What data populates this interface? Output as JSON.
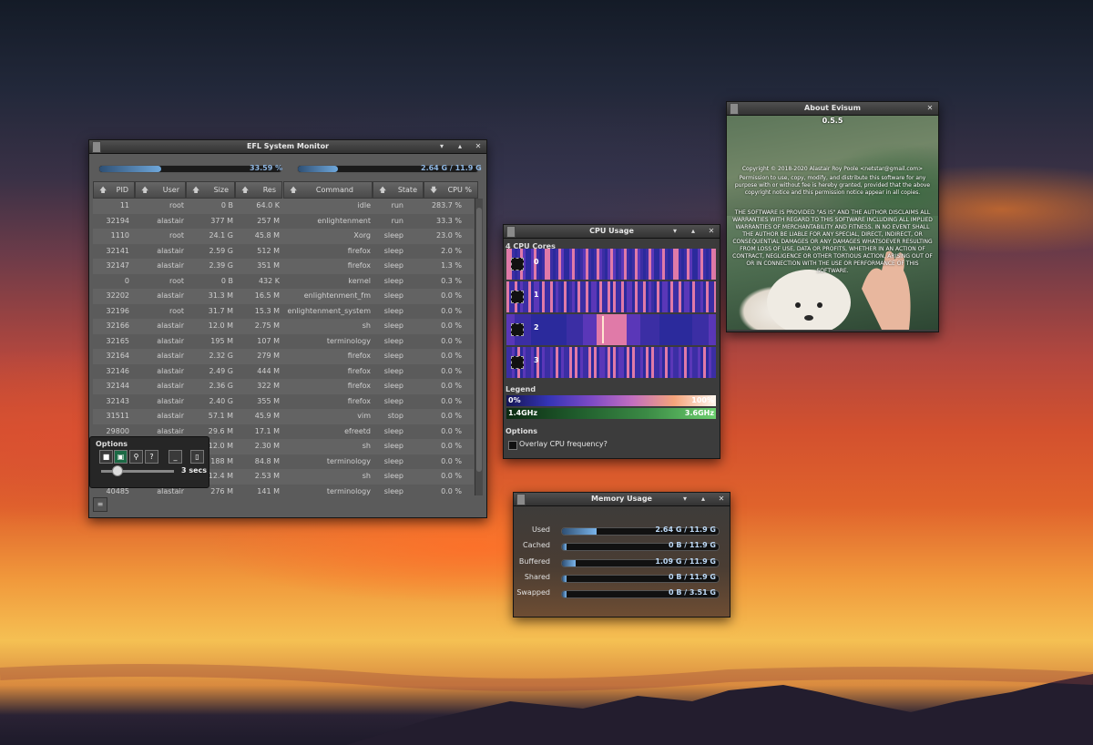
{
  "main": {
    "title": "EFL System Monitor",
    "cpu_percent": "33.59 %",
    "cpu_fill": 0.34,
    "mem_text": "2.64 G / 11.9 G",
    "mem_fill": 0.22,
    "columns": [
      "PID",
      "User",
      "Size",
      "Res",
      "Command",
      "State",
      "CPU %"
    ],
    "rows": [
      [
        "11",
        "root",
        "0 B",
        "64.0 K",
        "idle",
        "run",
        "283.7 %"
      ],
      [
        "32194",
        "alastair",
        "377 M",
        "257 M",
        "enlightenment",
        "run",
        "33.3 %"
      ],
      [
        "1110",
        "root",
        "24.1 G",
        "45.8 M",
        "Xorg",
        "sleep",
        "23.0 %"
      ],
      [
        "32141",
        "alastair",
        "2.59 G",
        "512 M",
        "firefox",
        "sleep",
        "2.0 %"
      ],
      [
        "32147",
        "alastair",
        "2.39 G",
        "351 M",
        "firefox",
        "sleep",
        "1.3 %"
      ],
      [
        "0",
        "root",
        "0 B",
        "432 K",
        "kernel",
        "sleep",
        "0.3 %"
      ],
      [
        "32202",
        "alastair",
        "31.3 M",
        "16.5 M",
        "enlightenment_fm",
        "sleep",
        "0.0 %"
      ],
      [
        "32196",
        "root",
        "31.7 M",
        "15.3 M",
        "enlightenment_system",
        "sleep",
        "0.0 %"
      ],
      [
        "32166",
        "alastair",
        "12.0 M",
        "2.75 M",
        "sh",
        "sleep",
        "0.0 %"
      ],
      [
        "32165",
        "alastair",
        "195 M",
        "107 M",
        "terminology",
        "sleep",
        "0.0 %"
      ],
      [
        "32164",
        "alastair",
        "2.32 G",
        "279 M",
        "firefox",
        "sleep",
        "0.0 %"
      ],
      [
        "32146",
        "alastair",
        "2.49 G",
        "444 M",
        "firefox",
        "sleep",
        "0.0 %"
      ],
      [
        "32144",
        "alastair",
        "2.36 G",
        "322 M",
        "firefox",
        "sleep",
        "0.0 %"
      ],
      [
        "32143",
        "alastair",
        "2.40 G",
        "355 M",
        "firefox",
        "sleep",
        "0.0 %"
      ],
      [
        "31511",
        "alastair",
        "57.1 M",
        "45.9 M",
        "vim",
        "stop",
        "0.0 %"
      ],
      [
        "29800",
        "alastair",
        "29.6 M",
        "17.1 M",
        "efreetd",
        "sleep",
        "0.0 %"
      ],
      [
        "",
        "",
        "12.0 M",
        "2.30 M",
        "sh",
        "sleep",
        "0.0 %"
      ],
      [
        "",
        "",
        "188 M",
        "84.8 M",
        "terminology",
        "sleep",
        "0.0 %"
      ],
      [
        "",
        "",
        "12.4 M",
        "2.53 M",
        "sh",
        "sleep",
        "0.0 %"
      ],
      [
        "40485",
        "alastair",
        "276 M",
        "141 M",
        "terminology",
        "sleep",
        "0.0 %"
      ]
    ],
    "options_label": "Options",
    "interval": "3 secs",
    "interval_level": 0.15
  },
  "cpu": {
    "title": "CPU Usage",
    "cores_label": "4 CPU Cores",
    "cores": [
      "0",
      "1",
      "2",
      "3"
    ],
    "legend_label": "Legend",
    "legend_min": "0%",
    "legend_max": "100%",
    "freq_min": "1.4GHz",
    "freq_max": "3.6GHz",
    "options_label": "Options",
    "overlay_label": "Overlay CPU frequency?"
  },
  "memory": {
    "title": "Memory Usage",
    "items": [
      {
        "label": "Used",
        "value": "2.64 G / 11.9 G",
        "fill": 0.22
      },
      {
        "label": "Cached",
        "value": "0 B / 11.9 G",
        "fill": 0.03
      },
      {
        "label": "Buffered",
        "value": "1.09 G / 11.9 G",
        "fill": 0.09
      },
      {
        "label": "Shared",
        "value": "0 B / 11.9 G",
        "fill": 0.03
      },
      {
        "label": "Swapped",
        "value": "0 B / 3.51 G",
        "fill": 0.03
      }
    ]
  },
  "about": {
    "title": "About Evisum",
    "version": "0.5.5",
    "copyright": "Copyright © 2018-2020 Alastair Roy Poole <netstar@gmail.com>",
    "license": "Permission to use, copy, modify, and distribute this software for any purpose with or without fee is hereby granted, provided that the above copyright notice and this permission notice appear in all copies.",
    "disclaimer": "THE SOFTWARE IS PROVIDED \"AS IS\" AND THE AUTHOR DISCLAIMS ALL WARRANTIES WITH REGARD TO THIS SOFTWARE INCLUDING ALL IMPLIED WARRANTIES OF MERCHANTABILITY AND FITNESS. IN NO EVENT SHALL THE AUTHOR BE LIABLE FOR ANY SPECIAL, DIRECT, INDIRECT, OR CONSEQUENTIAL DAMAGES OR ANY DAMAGES WHATSOEVER RESULTING FROM LOSS OF USE, DATA OR PROFITS, WHETHER IN AN ACTION OF CONTRACT, NEGLIGENCE OR OTHER TORTIOUS ACTION, ARISING OUT OF OR IN CONNECTION WITH THE USE OR PERFORMANCE OF THIS SOFTWARE."
  },
  "colors": {
    "accent": "#8fb7e3",
    "heat_low": "#2b2a9c",
    "heat_high": "#f5a978"
  }
}
